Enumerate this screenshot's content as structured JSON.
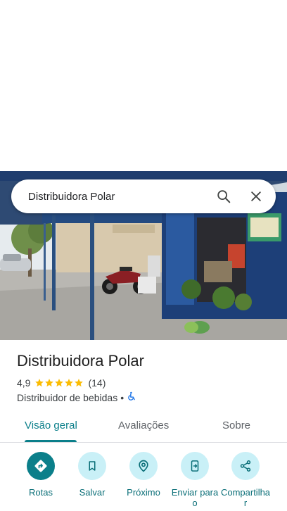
{
  "search": {
    "query": "Distribuidora Polar"
  },
  "place": {
    "name": "Distribuidora Polar",
    "rating": "4,9",
    "stars_filled": 5,
    "review_count": "(14)",
    "category": "Distribuidor de bebidas",
    "separator": "•",
    "accessibility_icon": "wheelchair-icon"
  },
  "tabs": [
    {
      "label": "Visão geral",
      "active": true
    },
    {
      "label": "Avaliações",
      "active": false
    },
    {
      "label": "Sobre",
      "active": false
    }
  ],
  "actions": [
    {
      "label": "Rotas",
      "icon": "directions-icon",
      "primary": true
    },
    {
      "label": "Salvar",
      "icon": "bookmark-icon",
      "primary": false
    },
    {
      "label": "Próximo",
      "icon": "nearby-icon",
      "primary": false
    },
    {
      "label": "Enviar para o",
      "icon": "send-to-phone-icon",
      "primary": false
    },
    {
      "label": "Compartilhar",
      "icon": "share-icon",
      "primary": false
    }
  ],
  "colors": {
    "accent": "#0b7f8a",
    "action_bg": "#c9f0f7",
    "star": "#fbbc04"
  }
}
